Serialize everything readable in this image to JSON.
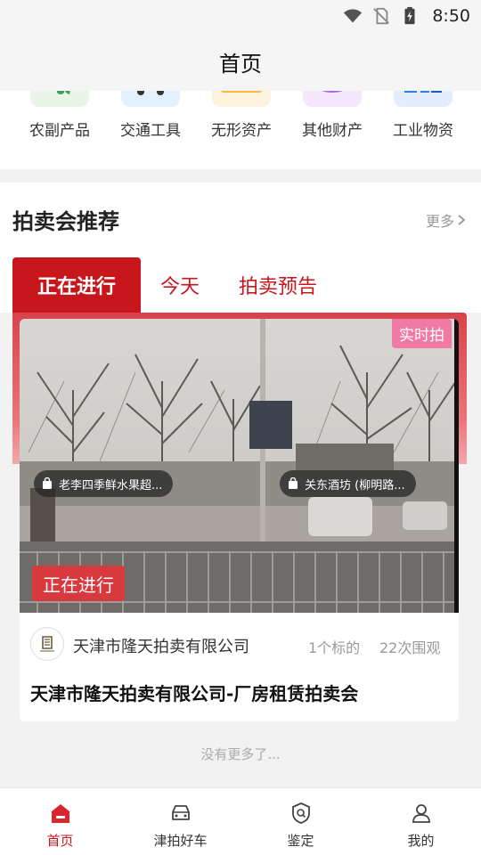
{
  "status_bar": {
    "time": "8:50"
  },
  "header": {
    "title": "首页"
  },
  "categories": [
    {
      "label": "农副产品",
      "icon": "produce-icon",
      "color": "#4caf50"
    },
    {
      "label": "交通工具",
      "icon": "truck-icon",
      "color": "#2196f3"
    },
    {
      "label": "无形资产",
      "icon": "asset-card-icon",
      "color": "#f6b93b"
    },
    {
      "label": "其他财产",
      "icon": "property-icon",
      "color": "#b06ad8"
    },
    {
      "label": "工业物资",
      "icon": "industry-icon",
      "color": "#2f7fe0"
    }
  ],
  "auction_section": {
    "title": "拍卖会推荐",
    "more": "更多",
    "tabs": [
      "正在进行",
      "今天",
      "拍卖预告"
    ]
  },
  "auction_card": {
    "live_badge": "实时拍",
    "shop_tags": [
      "老李四季鲜水果超...",
      "关东酒坊 (柳明路..."
    ],
    "status": "正在进行",
    "company": "天津市隆天拍卖有限公司",
    "lots": "1个标的",
    "views": "22次围观",
    "title": "天津市隆天拍卖有限公司-厂房租赁拍卖会"
  },
  "footer_note": "没有更多了...",
  "bottom_nav": [
    {
      "label": "首页",
      "icon": "home-icon",
      "active": true
    },
    {
      "label": "津拍好车",
      "icon": "car-icon",
      "active": false
    },
    {
      "label": "鉴定",
      "icon": "appraisal-shield-icon",
      "active": false
    },
    {
      "label": "我的",
      "icon": "profile-icon",
      "active": false
    }
  ],
  "colors": {
    "brand_red": "#c8161d",
    "live_pink": "#f07aa4"
  }
}
